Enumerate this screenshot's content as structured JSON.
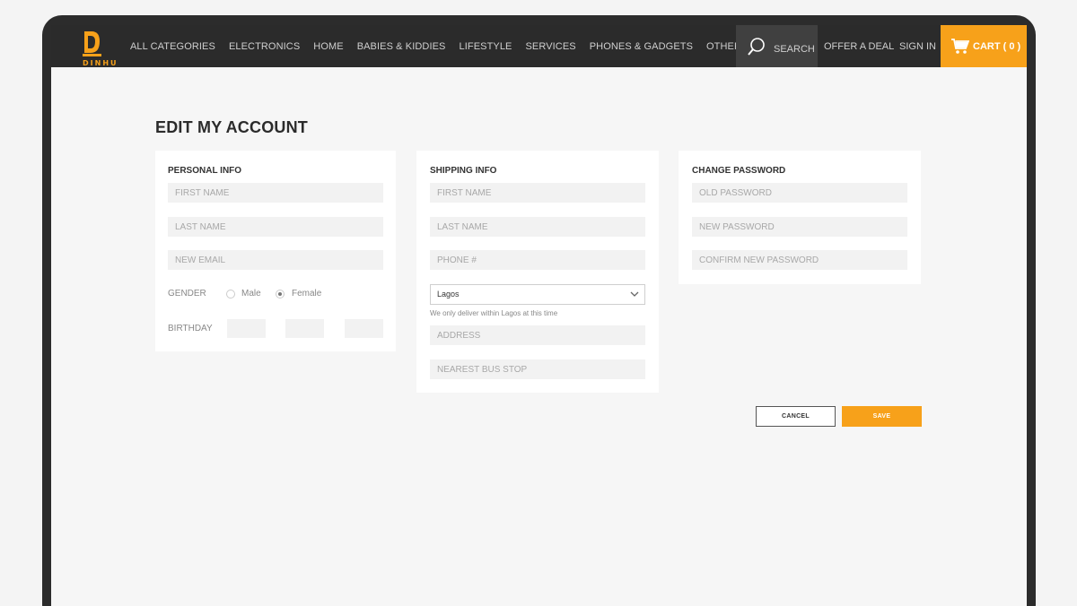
{
  "brand": {
    "name": "DINHU",
    "accent": "#f7a11a",
    "nav_bg": "#2b2b2b"
  },
  "nav": {
    "links": [
      "ALL CATEGORIES",
      "ELECTRONICS",
      "HOME",
      "BABIES & KIDDIES",
      "LIFESTYLE",
      "SERVICES",
      "PHONES & GADGETS",
      "OTHERS"
    ],
    "search_label": "SEARCH",
    "offer_label": "OFFER A DEAL",
    "signin_label": "SIGN IN",
    "cart_label": "CART ( 0 )"
  },
  "page": {
    "title": "EDIT MY ACCOUNT"
  },
  "personal": {
    "title": "PERSONAL INFO",
    "first_name_placeholder": "FIRST NAME",
    "last_name_placeholder": "LAST NAME",
    "email_placeholder": "NEW EMAIL",
    "gender_label": "GENDER",
    "male_label": "Male",
    "female_label": "Female",
    "gender_selected": "Female",
    "birthday_label": "BIRTHDAY"
  },
  "shipping": {
    "title": "SHIPPING INFO",
    "first_name_placeholder": "FIRST NAME",
    "last_name_placeholder": "LAST NAME",
    "phone_placeholder": "PHONE #",
    "city_value": "Lagos",
    "city_note": "We only deliver within Lagos at this time",
    "address_placeholder": "ADDRESS",
    "bus_stop_placeholder": "NEAREST BUS STOP"
  },
  "password": {
    "title": "CHANGE PASSWORD",
    "old_placeholder": "OLD PASSWORD",
    "new_placeholder": "NEW PASSWORD",
    "confirm_placeholder": "CONFIRM NEW PASSWORD"
  },
  "actions": {
    "cancel_label": "CANCEL",
    "save_label": "SAVE"
  }
}
